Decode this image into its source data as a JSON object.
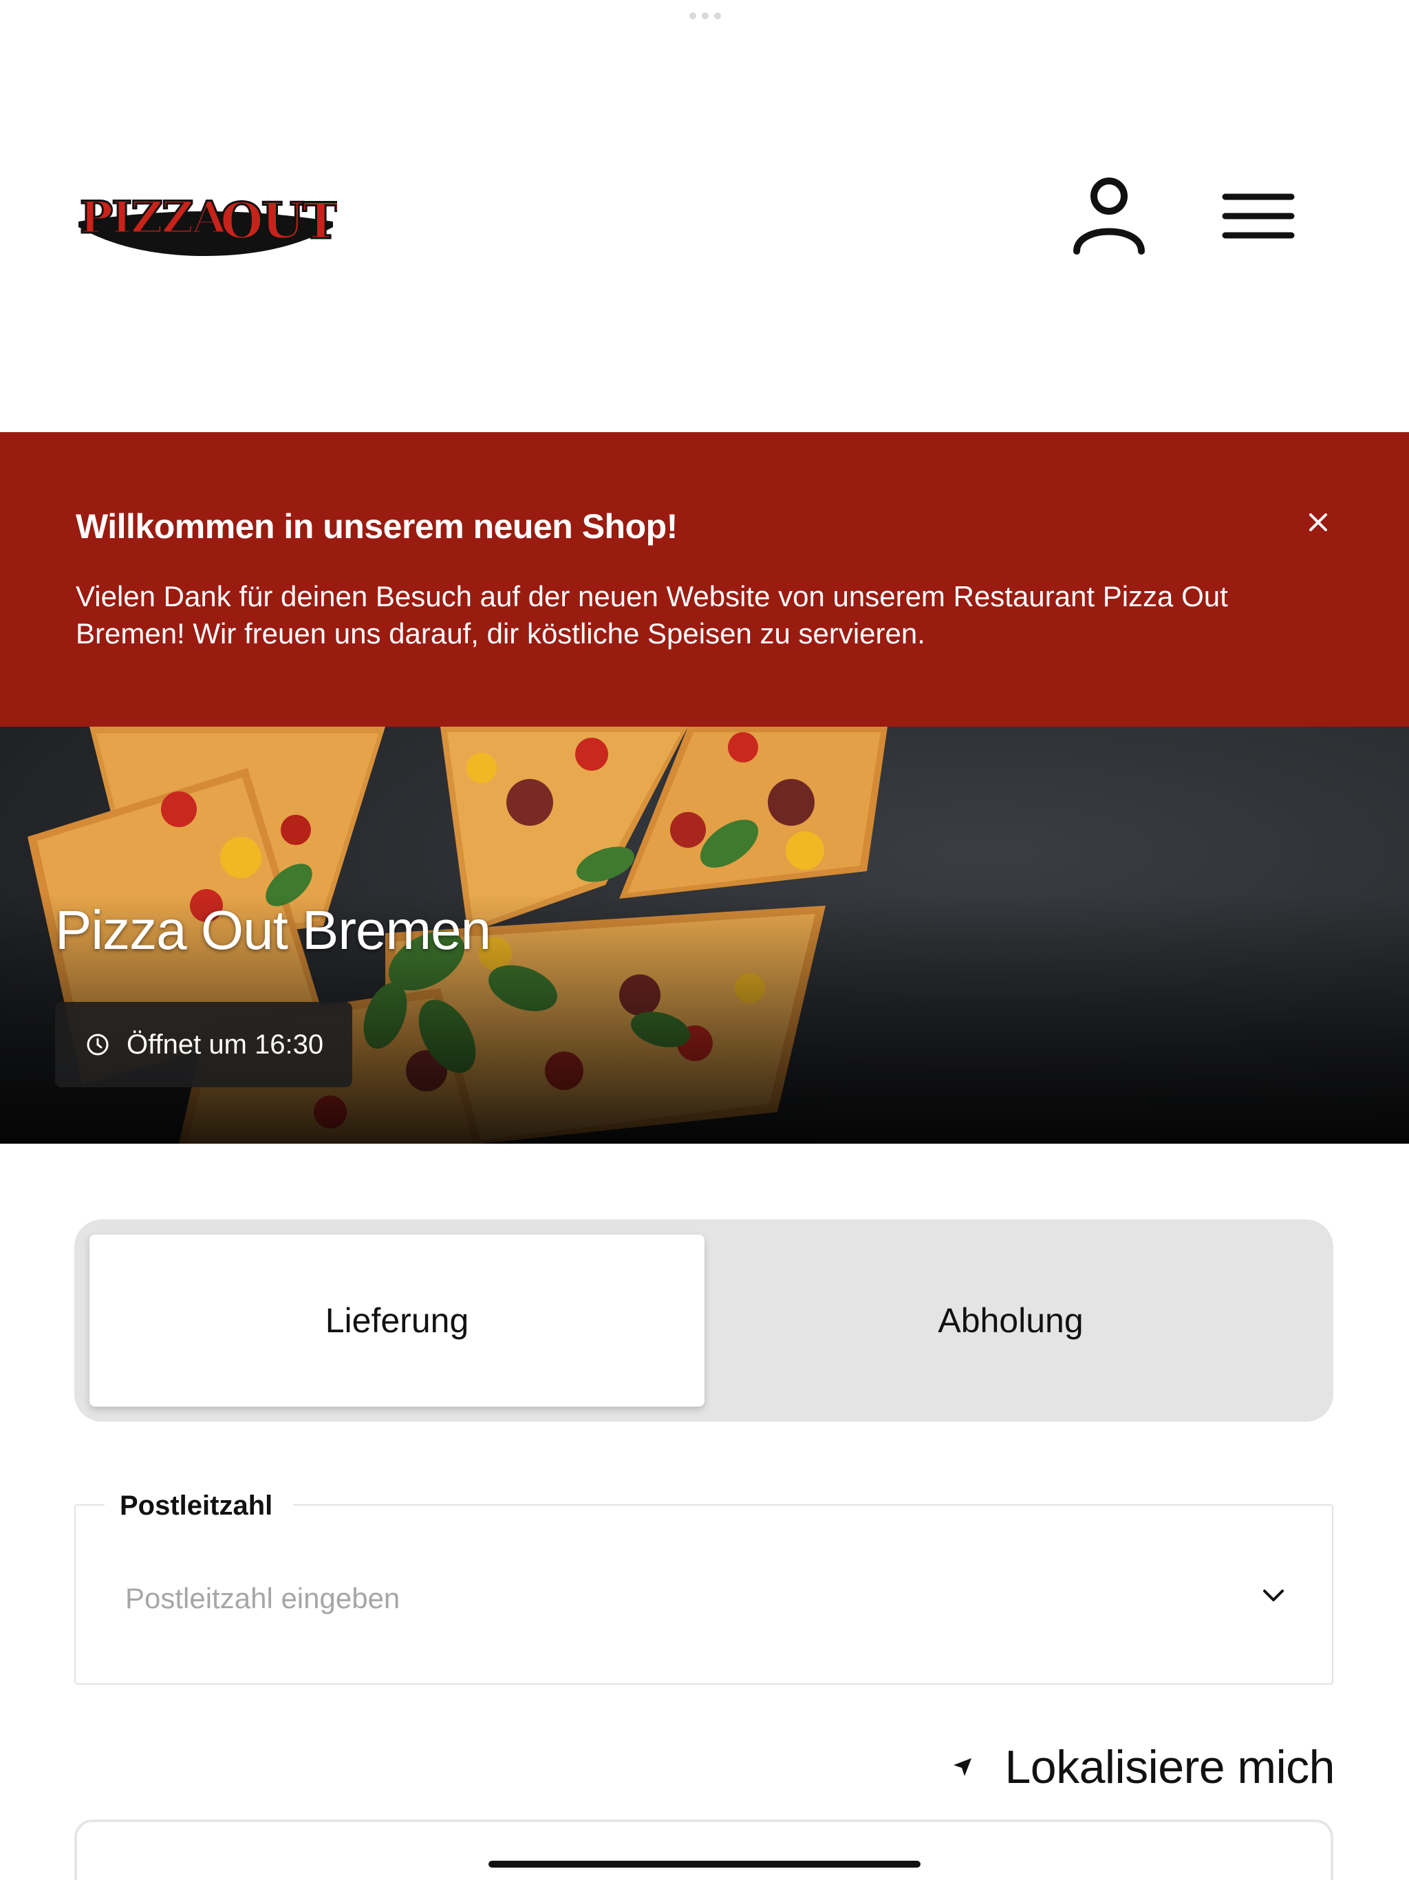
{
  "header": {
    "logo_text": "PIZZA OUT",
    "account_icon": "user-icon",
    "menu_icon": "hamburger-menu-icon"
  },
  "banner": {
    "title": "Willkommen in unserem neuen Shop!",
    "text": "Vielen Dank für deinen Besuch auf der neuen Website von unserem Restaurant Pizza Out Bremen! Wir freuen uns darauf, dir köstliche Speisen zu servieren.",
    "close_icon": "close-icon",
    "background_color": "#9a1b10"
  },
  "hero": {
    "title": "Pizza Out Bremen",
    "hours_text": "Öffnet um 16:30",
    "clock_icon": "clock-icon"
  },
  "order_type": {
    "options": [
      {
        "label": "Lieferung",
        "selected": true
      },
      {
        "label": "Abholung",
        "selected": false
      }
    ]
  },
  "zip": {
    "label": "Postleitzahl",
    "placeholder": "Postleitzahl eingeben",
    "value": "",
    "chevron_icon": "chevron-down-icon"
  },
  "locate": {
    "label": "Lokalisiere mich",
    "icon": "location-arrow-icon"
  }
}
